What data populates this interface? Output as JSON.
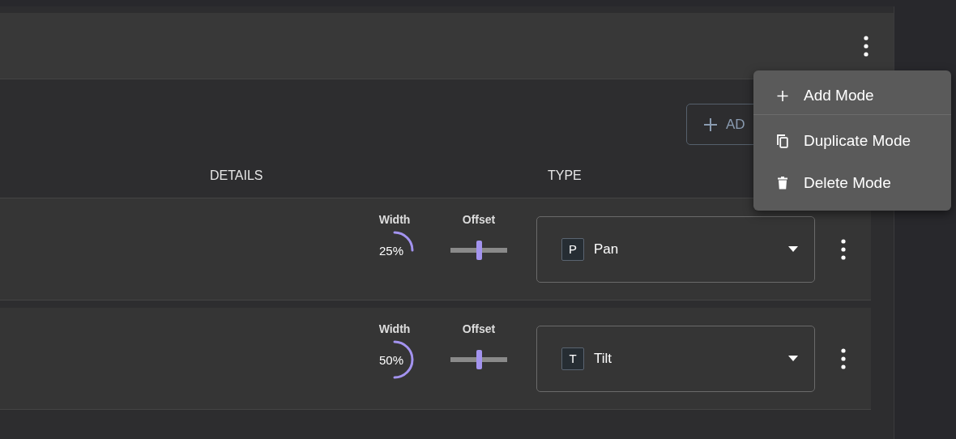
{
  "add_button": {
    "label": "AD"
  },
  "columns": [
    "DETAILS",
    "TYPE"
  ],
  "rows": [
    {
      "width": {
        "label": "Width",
        "reading": "25%"
      },
      "offset": {
        "label": "Offset",
        "level": 0.5
      },
      "type_letter": "P",
      "type": "Pan"
    },
    {
      "width": {
        "label": "Width",
        "reading": "50%"
      },
      "offset": {
        "label": "Offset",
        "level": 0.5
      },
      "type_letter": "T",
      "type": "Tilt"
    }
  ],
  "menu": [
    {
      "kind": "add",
      "label": "Add Mode"
    },
    {
      "kind": "duplicate",
      "label": "Duplicate Mode"
    },
    {
      "kind": "delete",
      "label": "Delete Mode"
    }
  ]
}
